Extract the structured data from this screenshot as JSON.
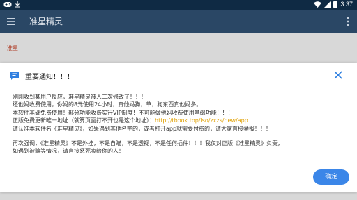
{
  "status_bar": {
    "time": "3:37",
    "icons": [
      "gamepad-icon",
      "download-icon",
      "wifi-icon",
      "signal-icon",
      "battery-icon"
    ]
  },
  "app_bar": {
    "title": "准星精灵",
    "menu_icon": "hamburger-menu-icon",
    "more_icon": "more-vert-icon"
  },
  "background": {
    "label": "准星"
  },
  "dialog": {
    "title": "重要通知！！！",
    "lines": [
      "刚刚收到某用户反应，准星精灵被人二次修改了！！！",
      "还他妈收费使用，你妈的8元使用24小时，真他妈狗，草，狗东西真他妈多。",
      "本软件基础免费使用！部分功能收费实行VIP制度！不可能做他妈收费使用基础功能！！！",
      "正版免费更新唯一地址（就算页面打不开也是这个地址）：",
      "请认准本软件名《准星精灵》，如果遇到其他名字的，或者打开app就需要付费的，请大家直接举报！！！",
      "再次强调，《准星精灵》不是外挂，不是自瞄，不是透视，不是任何插件！！！我仅对正版《准星精灵》负责，",
      "如遇到被骗等情况，请直接怒死卖给你的人！"
    ],
    "link": "http://tbook.top/iso/zxzs/new/app",
    "ok_label": "确定"
  },
  "colors": {
    "status_bar": "#0f2a44",
    "app_bar": "#2a4765",
    "link": "#e0a000",
    "button": "#3b86e8",
    "accent_icon": "#2f7fe0"
  }
}
